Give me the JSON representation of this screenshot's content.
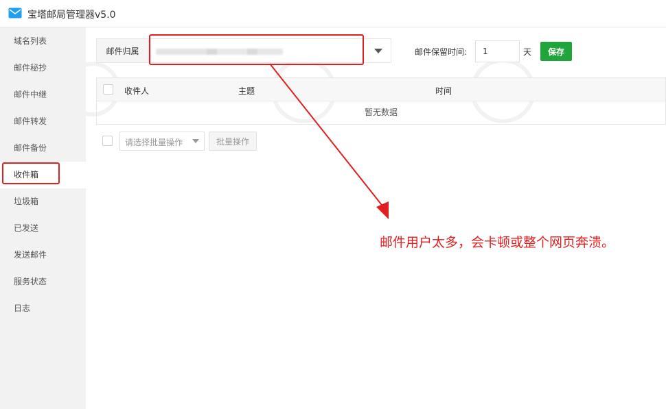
{
  "window": {
    "title": "宝塔邮局管理器v5.0",
    "icon": "envelope-icon"
  },
  "sidebar": {
    "items": [
      {
        "label": "域名列表"
      },
      {
        "label": "邮件秘抄"
      },
      {
        "label": "邮件中继"
      },
      {
        "label": "邮件转发"
      },
      {
        "label": "邮件备份"
      },
      {
        "label": "收件箱",
        "active": true
      },
      {
        "label": "垃圾箱"
      },
      {
        "label": "已发送"
      },
      {
        "label": "发送邮件"
      },
      {
        "label": "服务状态"
      },
      {
        "label": "日志"
      }
    ]
  },
  "filter": {
    "owner_label": "邮件归属",
    "retention_label": "邮件保留时间:",
    "retention_value": "1",
    "retention_unit": "天",
    "save_label": "保存"
  },
  "table": {
    "columns": {
      "recipient": "收件人",
      "subject": "主题",
      "time": "时间"
    },
    "empty_text": "暂无数据"
  },
  "batch": {
    "select_placeholder": "请选择批量操作",
    "button_label": "批量操作"
  },
  "annotation": {
    "text": "邮件用户太多，会卡顿或整个网页奔溃。"
  },
  "colors": {
    "accent_green": "#20a53a",
    "annotation_red": "#e02020",
    "app_blue": "#1e9ff2"
  }
}
